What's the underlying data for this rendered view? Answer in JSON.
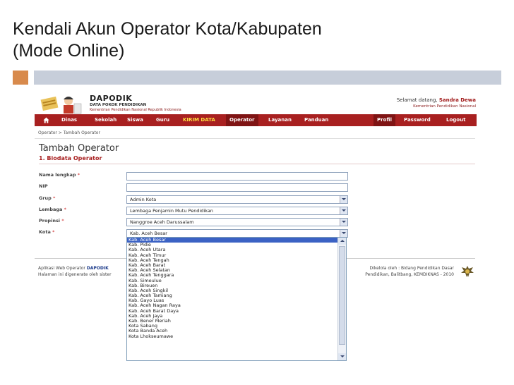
{
  "slide": {
    "title_line1": "Kendali Akun Operator Kota/Kabupaten",
    "title_line2": "(Mode Online)"
  },
  "app": {
    "brand_name": "DAPODIK",
    "brand_sub": "DATA POKOK PENDIDIKAN",
    "brand_org": "Kementrian Pendidikan Nasional Republik Indonesia",
    "welcome_prefix": "Selamat datang,",
    "welcome_user": "Sandra Dewa",
    "welcome_org": "Kementrian Pendidikan Nasional"
  },
  "nav": {
    "items": [
      "Dinas",
      "Sekolah",
      "Siswa",
      "Guru",
      "KIRIM DATA",
      "Operator",
      "Layanan",
      "Panduan"
    ],
    "right": [
      "Profil",
      "Password",
      "Logout"
    ]
  },
  "breadcrumb": "Operator > Tambah Operator",
  "page": {
    "title": "Tambah Operator",
    "section": "1. Biodata Operator"
  },
  "form": {
    "fields": [
      {
        "label": "Nama lengkap",
        "required": "*",
        "value": ""
      },
      {
        "label": "NIP",
        "required": "",
        "value": ""
      },
      {
        "label": "Grup",
        "required": "*",
        "value": "Admin Kota"
      },
      {
        "label": "Lembaga",
        "required": "*",
        "value": "Lembaga Penjamin Mutu Pendidikan"
      },
      {
        "label": "Propinsi",
        "required": "*",
        "value": "Nanggroe Aceh Darussalam"
      },
      {
        "label": "Kota",
        "required": "*",
        "value": "Kab. Aceh Besar"
      }
    ]
  },
  "kota_options": [
    "Kab. Aceh Besar",
    "Kab. Pidie",
    "Kab. Aceh Utara",
    "Kab. Aceh Timur",
    "Kab. Aceh Tengah",
    "Kab. Aceh Barat",
    "Kab. Aceh Selatan",
    "Kab. Aceh Tenggara",
    "Kab. Simeulue",
    "Kab. Bireuen",
    "Kab. Aceh Singkil",
    "Kab. Aceh Tamiang",
    "Kab. Gayo Luas",
    "Kab. Aceh Nagan Raya",
    "Kab. Aceh Barat Daya",
    "Kab. Aceh Jaya",
    "Kab. Bener Meriah",
    "Kota Sabang",
    "Kota Banda Aceh",
    "Kota Lhokseumawe"
  ],
  "footer": {
    "left_1_prefix": "Aplikasi Web Operator",
    "left_1_brand": "DAPODIK",
    "left_2": "Halaman ini digenerate oleh sister",
    "right_1": "Dikelola oleh : Bidang Pendidikan Dasar",
    "right_2": "Pendidikan, Balitbang, KEMDIKNAS - 2010"
  },
  "colors": {
    "accent": "#a82020",
    "slide_bar_orange": "#d88a4c",
    "slide_bar_blue": "#c7ceda",
    "selection": "#3b62c4"
  }
}
